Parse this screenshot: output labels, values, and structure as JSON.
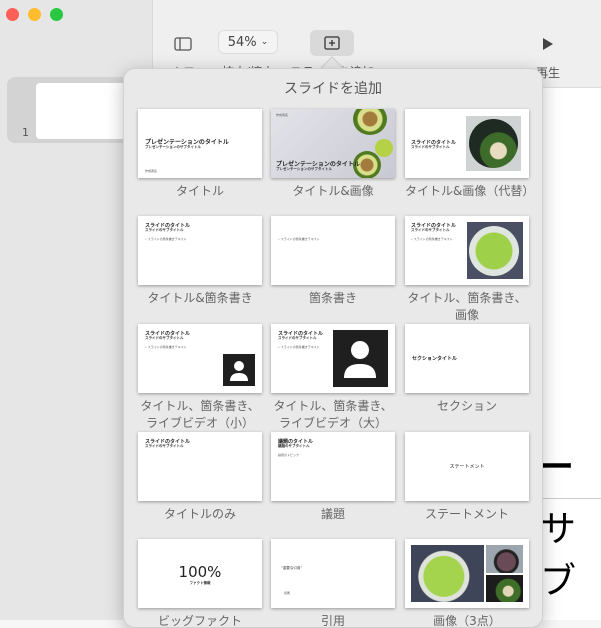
{
  "toolbar": {
    "view": "表示",
    "zoom_value": "54%",
    "zoom": "拡大/縮小",
    "add_slide": "スライドを追加",
    "play": "再生"
  },
  "sidebar": {
    "slide_number": "1"
  },
  "canvas": {
    "title_fragment": "ー",
    "subtitle_fragment": "サブ"
  },
  "popover": {
    "title": "スライドを追加",
    "layouts": [
      {
        "label": "タイトル",
        "title": "プレゼンテーションのタイトル",
        "subtitle": "プレゼンテーションのサブタイトル",
        "footer": "作成者名"
      },
      {
        "label": "タイトル&画像",
        "title": "プレゼンテーションのタイトル",
        "subtitle": "プレゼンテーションのサブタイトル",
        "footer": "作成者名"
      },
      {
        "label": "タイトル&画像（代替）",
        "title": "スライドのタイトル",
        "subtitle": "スライドのサブタイトル"
      },
      {
        "label": "タイトル&箇条書き",
        "title": "スライドのタイトル",
        "subtitle": "スライドのサブタイトル",
        "bullet": "• スライドの箇条書きテキスト"
      },
      {
        "label": "箇条書き",
        "bullet": "• スライドの箇条書きテキスト"
      },
      {
        "label": "タイトル、箇条書き、画像",
        "title": "スライドのタイトル",
        "subtitle": "スライドのサブタイトル",
        "bullet": "• スライドの箇条書きテキスト"
      },
      {
        "label": "タイトル、箇条書き、ライブビデオ（小）",
        "title": "スライドのタイトル",
        "subtitle": "スライドのサブタイトル",
        "bullet": "• スライドの箇条書きテキスト"
      },
      {
        "label": "タイトル、箇条書き、ライブビデオ（大）",
        "title": "スライドのタイトル",
        "subtitle": "スライドのサブタイトル",
        "bullet": "• スライドの箇条書きテキスト"
      },
      {
        "label": "セクション",
        "title": "セクションタイトル"
      },
      {
        "label": "タイトルのみ",
        "title": "スライドのタイトル",
        "subtitle": "スライドのサブタイトル"
      },
      {
        "label": "議題",
        "title": "議題のタイトル",
        "subtitle": "議題のサブタイトル",
        "bullet": "議題のトピック"
      },
      {
        "label": "ステートメント",
        "title": "ステートメント"
      },
      {
        "label": "ビッグファクト",
        "title": "100%",
        "subtitle": "ファクト情報"
      },
      {
        "label": "引用",
        "title": "“重要な引用”",
        "footer": "帰属"
      },
      {
        "label": "画像（3点）"
      }
    ]
  }
}
